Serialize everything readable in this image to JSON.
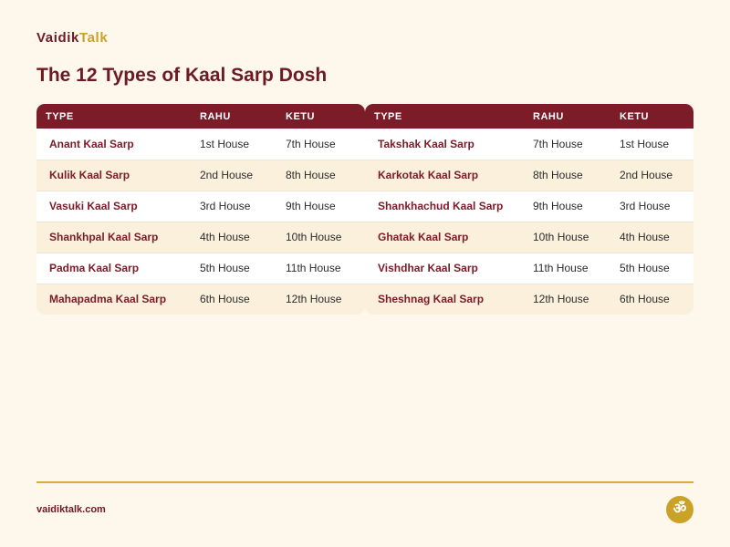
{
  "brand": {
    "part1": "Vaidik",
    "part2": "Talk"
  },
  "title": "The 12 Types of Kaal Sarp Dosh",
  "headers": {
    "type": "TYPE",
    "rahu": "RAHU",
    "ketu": "KETU"
  },
  "left_rows": [
    {
      "type": "Anant Kaal Sarp",
      "rahu": "1st House",
      "ketu": "7th House"
    },
    {
      "type": "Kulik Kaal Sarp",
      "rahu": "2nd House",
      "ketu": "8th House"
    },
    {
      "type": "Vasuki Kaal Sarp",
      "rahu": "3rd House",
      "ketu": "9th House"
    },
    {
      "type": "Shankhpal Kaal Sarp",
      "rahu": "4th House",
      "ketu": "10th House"
    },
    {
      "type": "Padma Kaal Sarp",
      "rahu": "5th House",
      "ketu": "11th House"
    },
    {
      "type": "Mahapadma Kaal Sarp",
      "rahu": "6th House",
      "ketu": "12th House"
    }
  ],
  "right_rows": [
    {
      "type": "Takshak Kaal Sarp",
      "rahu": "7th House",
      "ketu": "1st House"
    },
    {
      "type": "Karkotak Kaal Sarp",
      "rahu": "8th House",
      "ketu": "2nd House"
    },
    {
      "type": "Shankhachud Kaal Sarp",
      "rahu": "9th House",
      "ketu": "3rd House"
    },
    {
      "type": "Ghatak Kaal Sarp",
      "rahu": "10th House",
      "ketu": "4th House"
    },
    {
      "type": "Vishdhar Kaal Sarp",
      "rahu": "11th House",
      "ketu": "5th House"
    },
    {
      "type": "Sheshnag Kaal Sarp",
      "rahu": "12th House",
      "ketu": "6th House"
    }
  ],
  "footer": {
    "url": "vaidiktalk.com",
    "om_symbol": "ॐ",
    "om_icon": "om-icon"
  },
  "colors": {
    "maroon": "#7b1c28",
    "gold": "#c9a227",
    "background": "#fdf7ec"
  }
}
